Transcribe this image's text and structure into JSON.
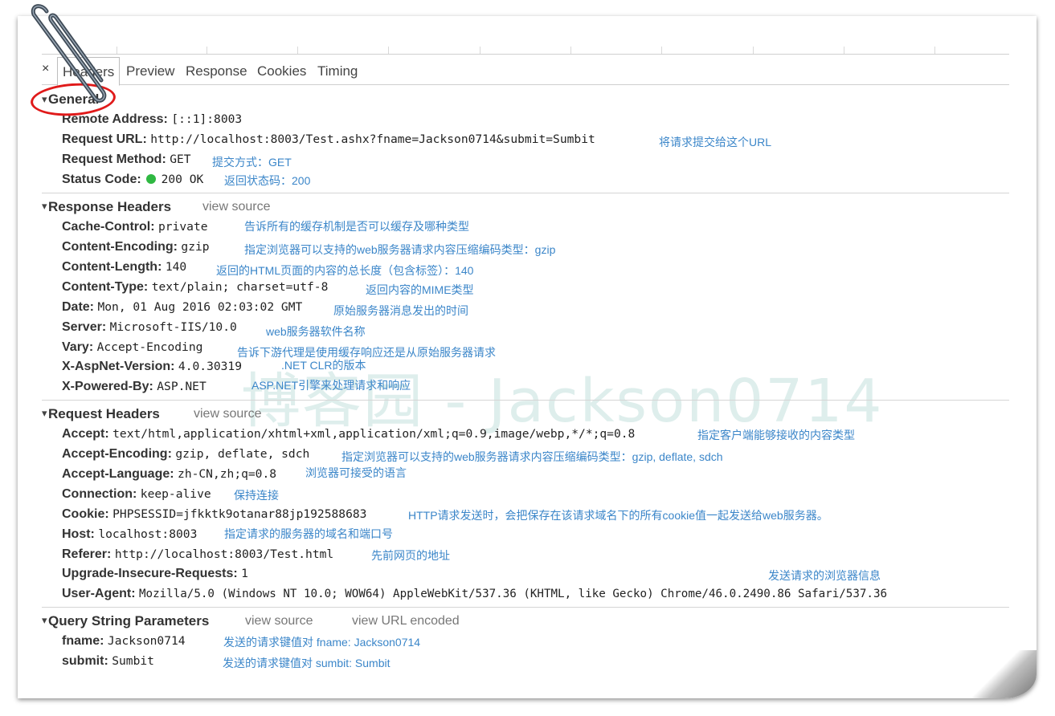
{
  "tabs": [
    "Headers",
    "Preview",
    "Response",
    "Cookies",
    "Timing"
  ],
  "tab_close": "×",
  "watermark": "博客园 - Jackson0714",
  "general": {
    "title": "General",
    "rows": [
      {
        "key": "Remote Address:",
        "value": "[::1]:8003",
        "note": ""
      },
      {
        "key": "Request URL:",
        "value": "http://localhost:8003/Test.ashx?fname=Jackson0714&submit=Sumbit",
        "note": "将请求提交给这个URL"
      },
      {
        "key": "Request Method:",
        "value": "GET",
        "note": "提交方式：GET"
      },
      {
        "key": "Status Code:",
        "value": "200 OK",
        "note": "返回状态码：200"
      }
    ]
  },
  "response_headers": {
    "title": "Response Headers",
    "view_source": "view source",
    "rows": [
      {
        "key": "Cache-Control:",
        "value": "private",
        "note": "告诉所有的缓存机制是否可以缓存及哪种类型"
      },
      {
        "key": "Content-Encoding:",
        "value": "gzip",
        "note": "指定浏览器可以支持的web服务器请求内容压缩编码类型：gzip"
      },
      {
        "key": "Content-Length:",
        "value": "140",
        "note": "返回的HTML页面的内容的总长度（包含标签）：140"
      },
      {
        "key": "Content-Type:",
        "value": "text/plain; charset=utf-8",
        "note": "返回内容的MIME类型"
      },
      {
        "key": "Date:",
        "value": "Mon, 01 Aug 2016 02:03:02 GMT",
        "note": "原始服务器消息发出的时间"
      },
      {
        "key": "Server:",
        "value": "Microsoft-IIS/10.0",
        "note": "web服务器软件名称"
      },
      {
        "key": "Vary:",
        "value": "Accept-Encoding",
        "note": "告诉下游代理是使用缓存响应还是从原始服务器请求"
      },
      {
        "key": "X-AspNet-Version:",
        "value": "4.0.30319",
        "note": ".NET CLR的版本"
      },
      {
        "key": "X-Powered-By:",
        "value": "ASP.NET",
        "note": "ASP.NET引擎来处理请求和响应"
      }
    ]
  },
  "request_headers": {
    "title": "Request Headers",
    "view_source": "view source",
    "rows": [
      {
        "key": "Accept:",
        "value": "text/html,application/xhtml+xml,application/xml;q=0.9,image/webp,*/*;q=0.8",
        "note": "指定客户端能够接收的内容类型"
      },
      {
        "key": "Accept-Encoding:",
        "value": "gzip, deflate, sdch",
        "note": "指定浏览器可以支持的web服务器请求内容压缩编码类型：gzip, deflate, sdch"
      },
      {
        "key": "Accept-Language:",
        "value": "zh-CN,zh;q=0.8",
        "note": "浏览器可接受的语言"
      },
      {
        "key": "Connection:",
        "value": "keep-alive",
        "note": "保持连接"
      },
      {
        "key": "Cookie:",
        "value": "PHPSESSID=jfkktk9otanar88jp192588683",
        "note": "HTTP请求发送时，会把保存在该请求域名下的所有cookie值一起发送给web服务器。"
      },
      {
        "key": "Host:",
        "value": "localhost:8003",
        "note": "指定请求的服务器的域名和端口号"
      },
      {
        "key": "Referer:",
        "value": "http://localhost:8003/Test.html",
        "note": "先前网页的地址"
      },
      {
        "key": "Upgrade-Insecure-Requests:",
        "value": "1",
        "note": "发送请求的浏览器信息"
      },
      {
        "key": "User-Agent:",
        "value": "Mozilla/5.0 (Windows NT 10.0; WOW64) AppleWebKit/537.36 (KHTML, like Gecko) Chrome/46.0.2490.86 Safari/537.36",
        "note": ""
      }
    ]
  },
  "query_string": {
    "title": "Query String Parameters",
    "view_source": "view source",
    "view_url_encoded": "view URL encoded",
    "rows": [
      {
        "key": "fname:",
        "value": "Jackson0714",
        "note": "发送的请求键值对 fname: Jackson0714"
      },
      {
        "key": "submit:",
        "value": "Sumbit",
        "note": "发送的请求键值对 sumbit: Sumbit"
      }
    ]
  },
  "colors": {
    "note": "#3b86c9",
    "status_ok": "#2fb842",
    "annotation": "#e01a1a"
  }
}
